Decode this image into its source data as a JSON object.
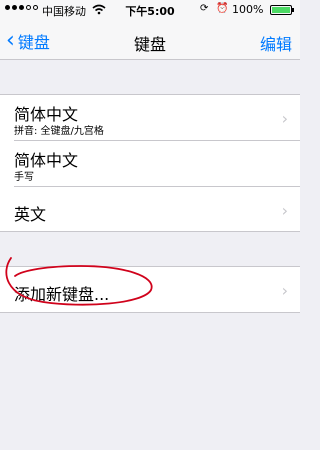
{
  "status_bar": {
    "carrier": "中国移动",
    "time": "下午5:00",
    "battery": "100%",
    "battery_level": 1.0,
    "icons": [
      "signal-icon",
      "wifi-icon",
      "lock-rotation-icon",
      "alarm-icon",
      "battery-icon"
    ]
  },
  "nav": {
    "back_label": "键盘",
    "title": "键盘",
    "edit_label": "编辑"
  },
  "keyboards": [
    {
      "title": "简体中文",
      "subtitle": "拼音: 全键盘/九宫格"
    },
    {
      "title": "简体中文",
      "subtitle": "手写"
    },
    {
      "title": "英文"
    }
  ],
  "add_keyboard": {
    "label": "添加新键盘..."
  },
  "colors": {
    "accent": "#007aff",
    "background": "#efeff4",
    "annotation": "#d0021b",
    "battery": "#4cd964"
  }
}
